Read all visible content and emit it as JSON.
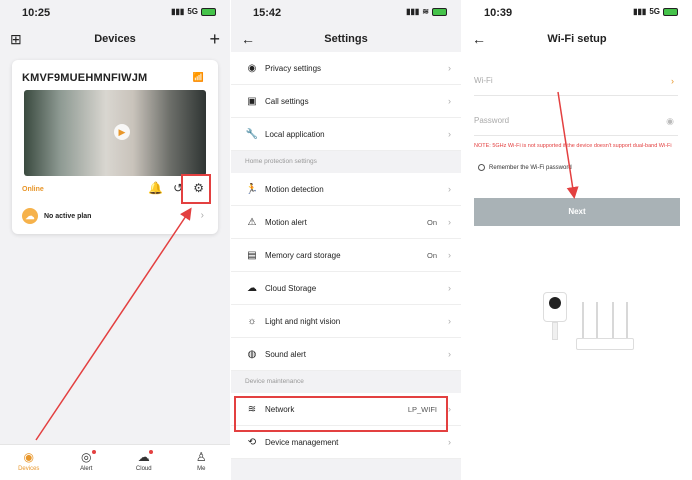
{
  "panel1": {
    "status": {
      "time": "10:25",
      "signal": "5G"
    },
    "header": {
      "title": "Devices",
      "grid_icon": "grid-icon",
      "add_icon": "plus-icon"
    },
    "device": {
      "name": "KMVF9MUEHMNFIWJM",
      "status": "Online",
      "plan": "No active plan"
    },
    "tabs": [
      {
        "label": "Devices",
        "icon": "camera-tab-icon"
      },
      {
        "label": "Alert",
        "icon": "alert-tab-icon"
      },
      {
        "label": "Cloud",
        "icon": "cloud-tab-icon"
      },
      {
        "label": "Me",
        "icon": "person-tab-icon"
      }
    ]
  },
  "panel2": {
    "status": {
      "time": "15:42"
    },
    "header": {
      "title": "Settings"
    },
    "rows_top": [
      {
        "label": "Privacy settings",
        "icon": "eye-icon"
      },
      {
        "label": "Call settings",
        "icon": "phone-icon"
      },
      {
        "label": "Local application",
        "icon": "wrench-icon"
      }
    ],
    "section1": "Home protection settings",
    "rows_mid": [
      {
        "label": "Motion detection",
        "icon": "runner-icon",
        "value": ""
      },
      {
        "label": "Motion alert",
        "icon": "siren-icon",
        "value": "On"
      },
      {
        "label": "Memory card storage",
        "icon": "sdcard-icon",
        "value": "On"
      },
      {
        "label": "Cloud Storage",
        "icon": "cloud-icon",
        "value": ""
      },
      {
        "label": "Light and night vision",
        "icon": "sun-icon",
        "value": ""
      },
      {
        "label": "Sound alert",
        "icon": "sound-icon",
        "value": ""
      }
    ],
    "section2": "Device maintenance",
    "rows_bottom": [
      {
        "label": "Network",
        "icon": "wifi-icon",
        "value": "LP_WIFI"
      },
      {
        "label": "Device management",
        "icon": "device-icon",
        "value": ""
      }
    ]
  },
  "panel3": {
    "status": {
      "time": "10:39",
      "signal": "5G"
    },
    "header": {
      "title": "Wi-Fi setup"
    },
    "wifi_label": "Wi-Fi",
    "password_label": "Password",
    "note": "NOTE: 5GHz Wi-Fi is not supported if the device doesn't support dual-band Wi-Fi",
    "remember": "Remember the Wi-Fi password",
    "next": "Next"
  },
  "colors": {
    "accent": "#e8962a",
    "highlight": "#e34040",
    "button": "#a9b2b6"
  }
}
